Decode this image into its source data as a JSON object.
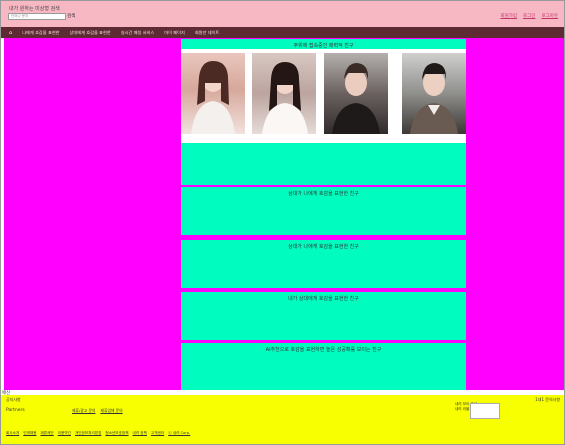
{
  "header": {
    "tagline": "내가 원하는 미상형 검색",
    "search_placeholder": "단어나 문자",
    "search_button": "검색",
    "auth_links": [
      "회원가입",
      "로그인",
      "로그아웃"
    ]
  },
  "nav": {
    "home_icon": "home-icon",
    "items": [
      "나에게 호감을 표현한",
      "상대에게 호감을 표현한",
      "실시간 매칭 서비스",
      "마이 페이지",
      "회원만 데이트"
    ]
  },
  "sections": [
    {
      "title": "주위에 접속중인 매력적 친구"
    },
    {
      "title": "상대가 나에게 호감을 표현한 친구"
    },
    {
      "title": "상대가 나에게 호감을 표현한 친구"
    },
    {
      "title": "내가 상대에게 호감을 표현한 친구"
    },
    {
      "title": "AI추천으로 호감을 표현하면 높은 성공확률 보이는 친구"
    }
  ],
  "status_text": "애신",
  "footer": {
    "left_title": "공지사항",
    "right_title": "1대1 문의사항",
    "partners_label": "Partners",
    "partner_links": [
      "제휴/광고 문의",
      "제휴업체 문의"
    ],
    "app_lines": [
      "내려 보아 주세",
      "내려 러블 다운로드"
    ],
    "bottom_links": [
      "회사소개",
      "인재채용",
      "제휴제안",
      "이용약관",
      "개인정보처리방침",
      "청소년보호정책",
      "내려 정책",
      "고객센터",
      "ⓒ 내려 Corp."
    ]
  },
  "colors": {
    "header_bg": "#f7b8c4",
    "nav_bg": "#5e2a34",
    "side_bg": "#ff00ff",
    "section_bg": "#00fcbe",
    "footer_bg": "#f8ff00"
  }
}
